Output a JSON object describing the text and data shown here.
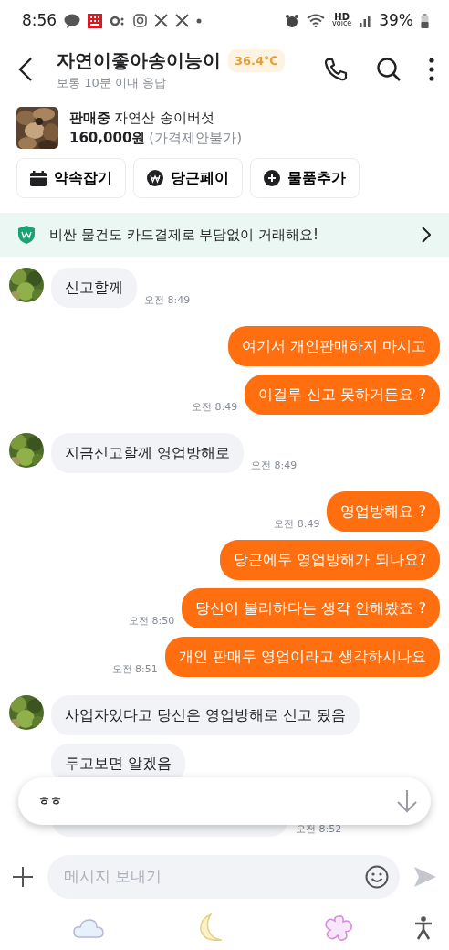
{
  "status_bar": {
    "time": "8:56",
    "network_label": "HD",
    "network_sublabel": "voice",
    "battery": "39%"
  },
  "header": {
    "title": "자연이좋아송이능이",
    "temperature": "36.4℃",
    "subtitle": "보통 10분 이내 응답"
  },
  "product": {
    "status": "판매중",
    "name": "자연산 송이버섯",
    "price": "160,000원",
    "price_note": "(가격제안불가)"
  },
  "actions": [
    {
      "kind": "calendar",
      "label": "약속잡기"
    },
    {
      "kind": "pay",
      "label": "당근페이"
    },
    {
      "kind": "add",
      "label": "물품추가"
    }
  ],
  "banner": {
    "text": "비싼 물건도 카드결제로 부담없이 거래해요!"
  },
  "messages": [
    {
      "kind": "incoming",
      "text": "신고할께",
      "time": "오전 8:49"
    },
    {
      "kind": "outgoing",
      "text": "여기서 개인판매하지 마시고"
    },
    {
      "kind": "outgoing",
      "text": "이걸루 신고 못하거든요 ?",
      "time": "오전 8:49"
    },
    {
      "kind": "incoming",
      "text": "지금신고할께   영업방해로",
      "time": "오전 8:49"
    },
    {
      "kind": "outgoing",
      "text": "영업방해요 ?",
      "time": "오전 8:49"
    },
    {
      "kind": "outgoing",
      "text": "당근에두 영업방해가 되나요?"
    },
    {
      "kind": "outgoing",
      "text": "당신이 불리하다는 생각 안해봤죠 ?",
      "time": "오전 8:50"
    },
    {
      "kind": "outgoing",
      "text": "개인 판매두 영업이라고 생각하시나요",
      "time": "오전 8:51"
    },
    {
      "kind": "incoming",
      "text": "사업자있다고 당신은 영업방해로 신고 됬음"
    },
    {
      "kind": "incoming",
      "text": "두고보면 알겠음"
    },
    {
      "kind": "incoming",
      "time": "오전 8:52"
    }
  ],
  "new_message_preview": {
    "text": "ㅎㅎ"
  },
  "composer": {
    "placeholder": "메시지 보내기"
  }
}
